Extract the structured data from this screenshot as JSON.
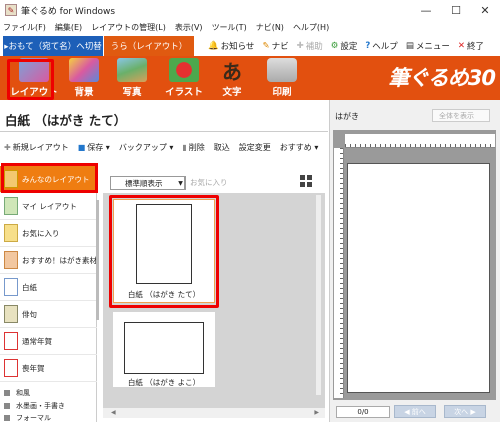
{
  "window": {
    "title": "筆ぐるめ for Windows",
    "minimize": "—",
    "maximize": "☐",
    "close": "✕"
  },
  "menubar": [
    "ファイル(F)",
    "編集(E)",
    "レイアウトの管理(L)",
    "表示(V)",
    "ツール(T)",
    "ナビ(N)",
    "ヘルプ(H)"
  ],
  "tabs": {
    "omote": "▸おもて（宛て名）へ切替",
    "ura": "うら（レイアウト）"
  },
  "top_tools": [
    {
      "icon": "bell-icon",
      "glyph": "🔔",
      "label": "お知らせ",
      "color": "#d33"
    },
    {
      "icon": "navi-icon",
      "glyph": "✎",
      "label": "ナビ",
      "color": "#d80"
    },
    {
      "icon": "plus-icon",
      "glyph": "✚",
      "label": "補助",
      "color": "#bbb"
    },
    {
      "icon": "gear-icon",
      "glyph": "⚙",
      "label": "設定",
      "color": "#393"
    },
    {
      "icon": "help-icon",
      "glyph": "?",
      "label": "ヘルプ",
      "color": "#27c"
    },
    {
      "icon": "menu-icon",
      "glyph": "▤",
      "label": "メニュー",
      "color": "#333"
    },
    {
      "icon": "close-icon",
      "glyph": "✕",
      "label": "終了",
      "color": "#d22"
    }
  ],
  "ribbon": [
    {
      "label": "レイアウト",
      "color": "#7aa3d9"
    },
    {
      "label": "背景",
      "color": "#d95aa0"
    },
    {
      "label": "写真",
      "color": "#6ab06a"
    },
    {
      "label": "イラスト",
      "color": "#4da84d"
    },
    {
      "label": "文字",
      "color": "#7a4a2a"
    },
    {
      "label": "印刷",
      "color": "#cccccc"
    }
  ],
  "brand": "筆ぐるめ30",
  "page_title": "白紙 （はがき たて）",
  "toolbar": [
    {
      "icon": "new-layout-icon",
      "label": "新規レイアウト"
    },
    {
      "icon": "save-icon",
      "label": "保存 ▾"
    },
    {
      "icon": "backup-icon",
      "label": "バックアップ ▾"
    },
    {
      "icon": "trash-icon",
      "label": "削除"
    },
    {
      "icon": "",
      "label": "取込"
    },
    {
      "icon": "",
      "label": "設定変更"
    },
    {
      "icon": "",
      "label": "おすすめ ▾"
    }
  ],
  "categories": [
    {
      "label": "みんなのレイアウト"
    },
    {
      "label": "マイ レイアウト"
    },
    {
      "label": "お気に入り"
    },
    {
      "label": "おすすめ！はがき素材"
    },
    {
      "label": "白紙"
    },
    {
      "label": "俳句"
    },
    {
      "label": "通常年賀"
    },
    {
      "label": "喪年賀"
    }
  ],
  "subcategories": [
    "和風",
    "水墨画・手書き",
    "フォーマル"
  ],
  "sort": {
    "value": "標準順表示",
    "favorites": "お気に入り"
  },
  "thumbnails": [
    {
      "caption": "白紙 （はがき たて）"
    },
    {
      "caption": "白紙 （はがき よこ）"
    }
  ],
  "preview": {
    "label": "はがき",
    "view": "全体を表示",
    "counter": "0/0",
    "prev": "◀ 前へ",
    "next": "次へ ▶"
  }
}
